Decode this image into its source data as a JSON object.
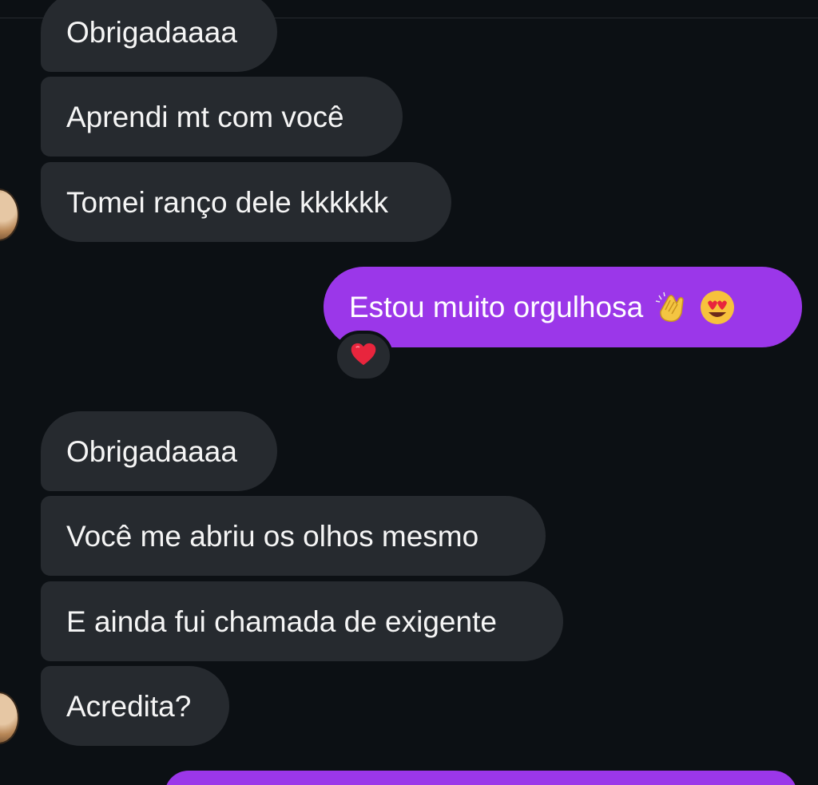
{
  "thread": {
    "messages_group_1": [
      {
        "text": "Obrigadaaaa"
      },
      {
        "text": "Aprendi mt com você"
      },
      {
        "text": "Tomei ranço dele kkkkkk"
      }
    ],
    "outgoing_1": {
      "text": "Estou muito orgulhosa",
      "emojis": [
        "clapping-hands-emoji",
        "heart-eyes-emoji"
      ],
      "reaction": "heart-emoji"
    },
    "messages_group_2": [
      {
        "text": "Obrigadaaaa"
      },
      {
        "text": "Você me abriu os olhos mesmo"
      },
      {
        "text": "E ainda fui chamada de exigente"
      },
      {
        "text": "Acredita?"
      }
    ]
  },
  "colors": {
    "background": "#0c1014",
    "incoming_bubble": "#262a2f",
    "outgoing_bubble": "#9b37e9",
    "text": "#f5f5f5"
  }
}
